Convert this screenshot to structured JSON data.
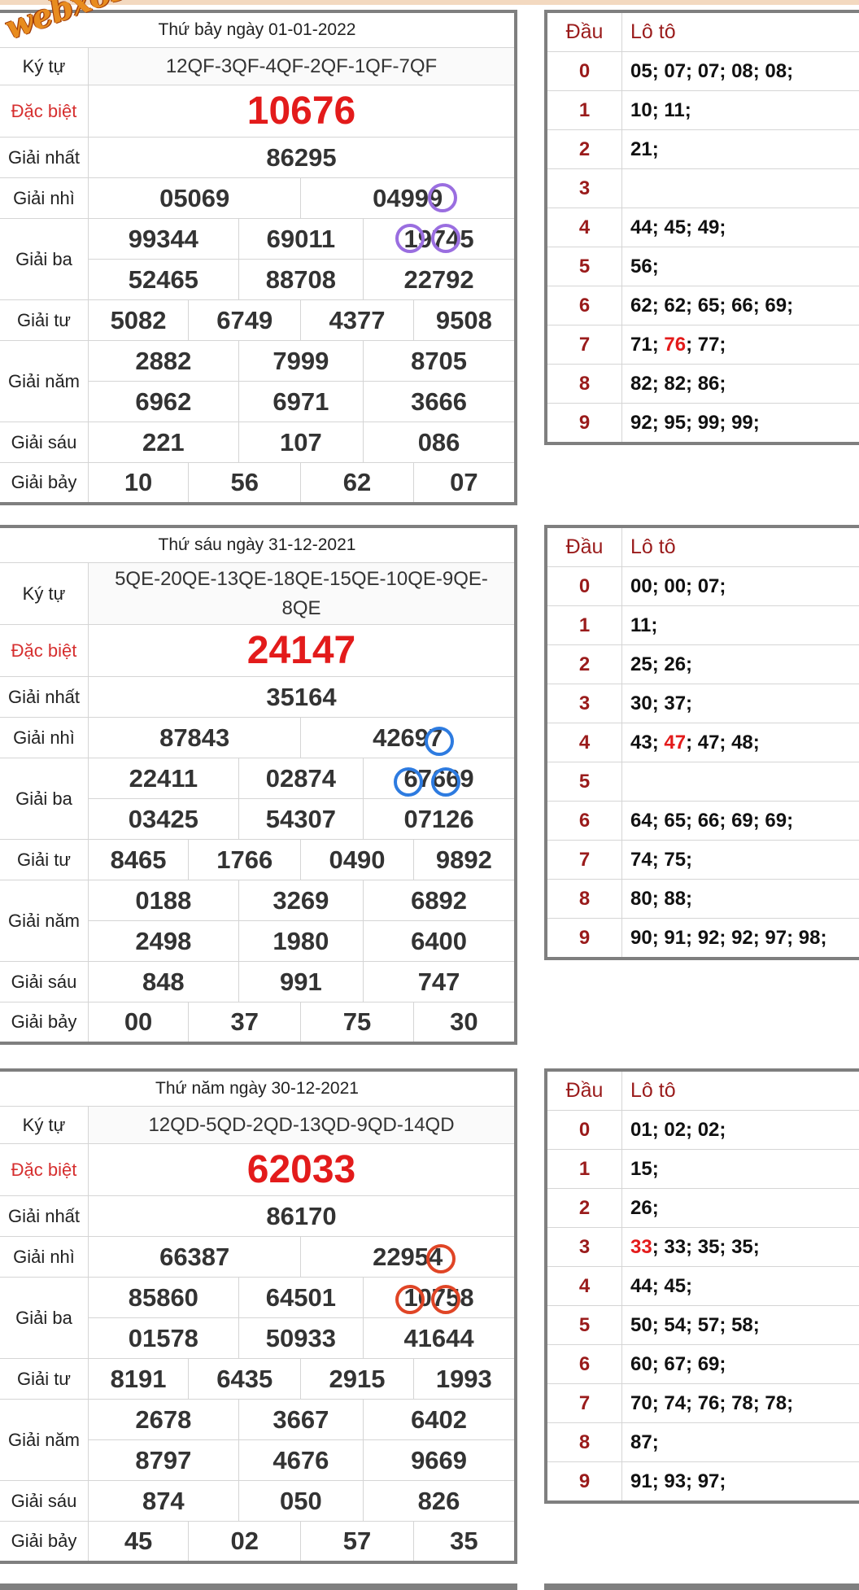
{
  "site_logo": "webxoso.net",
  "labels": {
    "kytu": "Ký tự",
    "db": "Đặc biệt",
    "g1": "Giải nhất",
    "g2": "Giải nhì",
    "g3": "Giải ba",
    "g4": "Giải tư",
    "g5": "Giải năm",
    "g6": "Giải sáu",
    "g7": "Giải bảy",
    "dau": "Đầu",
    "loto": "Lô tô"
  },
  "draws": [
    {
      "date_title": "Thứ bảy ngày 01-01-2022",
      "kytu": "12QF-3QF-4QF-2QF-1QF-7QF",
      "special": "10676",
      "first": "86295",
      "second": [
        "05069",
        "04999"
      ],
      "third": [
        "99344",
        "69011",
        "19745",
        "52465",
        "88708",
        "22792"
      ],
      "fourth": [
        "5082",
        "6749",
        "4377",
        "9508"
      ],
      "fifth": [
        "2882",
        "7999",
        "8705",
        "6962",
        "6971",
        "3666"
      ],
      "sixth": [
        "221",
        "107",
        "086"
      ],
      "seventh": [
        "10",
        "56",
        "62",
        "07"
      ],
      "loto": [
        {
          "dau": "0",
          "vals": "05; 07; 07; 08; 08;"
        },
        {
          "dau": "1",
          "vals": "10; 11;"
        },
        {
          "dau": "2",
          "vals": "21;"
        },
        {
          "dau": "3",
          "vals": ""
        },
        {
          "dau": "4",
          "vals": "44; 45; 49;"
        },
        {
          "dau": "5",
          "vals": "56;"
        },
        {
          "dau": "6",
          "vals": "62; 62; 65; 66; 69;"
        },
        {
          "dau": "7",
          "pre": "71; ",
          "hl": "76",
          "post": "; 77;"
        },
        {
          "dau": "8",
          "vals": "82; 82; 86;"
        },
        {
          "dau": "9",
          "vals": "92; 95; 99; 99;"
        }
      ]
    },
    {
      "date_title": "Thứ sáu ngày 31-12-2021",
      "kytu": "5QE-20QE-13QE-18QE-15QE-10QE-9QE-8QE",
      "special": "24147",
      "first": "35164",
      "second": [
        "87843",
        "42697"
      ],
      "third": [
        "22411",
        "02874",
        "67669",
        "03425",
        "54307",
        "07126"
      ],
      "fourth": [
        "8465",
        "1766",
        "0490",
        "9892"
      ],
      "fifth": [
        "0188",
        "3269",
        "6892",
        "2498",
        "1980",
        "6400"
      ],
      "sixth": [
        "848",
        "991",
        "747"
      ],
      "seventh": [
        "00",
        "37",
        "75",
        "30"
      ],
      "loto": [
        {
          "dau": "0",
          "vals": "00; 00; 07;"
        },
        {
          "dau": "1",
          "vals": "11;"
        },
        {
          "dau": "2",
          "vals": "25; 26;"
        },
        {
          "dau": "3",
          "vals": "30; 37;"
        },
        {
          "dau": "4",
          "pre": "43; ",
          "hl": "47",
          "post": "; 47; 48;"
        },
        {
          "dau": "5",
          "vals": ""
        },
        {
          "dau": "6",
          "vals": "64; 65; 66; 69; 69;"
        },
        {
          "dau": "7",
          "vals": "74; 75;"
        },
        {
          "dau": "8",
          "vals": "80; 88;"
        },
        {
          "dau": "9",
          "vals": "90; 91; 92; 92; 97; 98;"
        }
      ]
    },
    {
      "date_title": "Thứ năm ngày 30-12-2021",
      "kytu": "12QD-5QD-2QD-13QD-9QD-14QD",
      "special": "62033",
      "first": "86170",
      "second": [
        "66387",
        "22954"
      ],
      "third": [
        "85860",
        "64501",
        "10758",
        "01578",
        "50933",
        "41644"
      ],
      "fourth": [
        "8191",
        "6435",
        "2915",
        "1993"
      ],
      "fifth": [
        "2678",
        "3667",
        "6402",
        "8797",
        "4676",
        "9669"
      ],
      "sixth": [
        "874",
        "050",
        "826"
      ],
      "seventh": [
        "45",
        "02",
        "57",
        "35"
      ],
      "loto": [
        {
          "dau": "0",
          "vals": "01; 02; 02;"
        },
        {
          "dau": "1",
          "vals": "15;"
        },
        {
          "dau": "2",
          "vals": "26;"
        },
        {
          "dau": "3",
          "pre": "",
          "hl": "33",
          "post": "; 33; 35; 35;"
        },
        {
          "dau": "4",
          "vals": "44; 45;"
        },
        {
          "dau": "5",
          "vals": "50; 54; 57; 58;"
        },
        {
          "dau": "6",
          "vals": "60; 67; 69;"
        },
        {
          "dau": "7",
          "vals": "70; 74; 76; 78; 78;"
        },
        {
          "dau": "8",
          "vals": "87;"
        },
        {
          "dau": "9",
          "vals": "91; 93; 97;"
        }
      ]
    }
  ],
  "colors": {
    "special": "#e31b1b",
    "label_red": "#d62f2f",
    "dau": "#9a1b1b",
    "circle_1": "#9a6ee0",
    "circle_2": "#2d7be0",
    "circle_3": "#e04526",
    "frame": "#7f7f7f"
  }
}
